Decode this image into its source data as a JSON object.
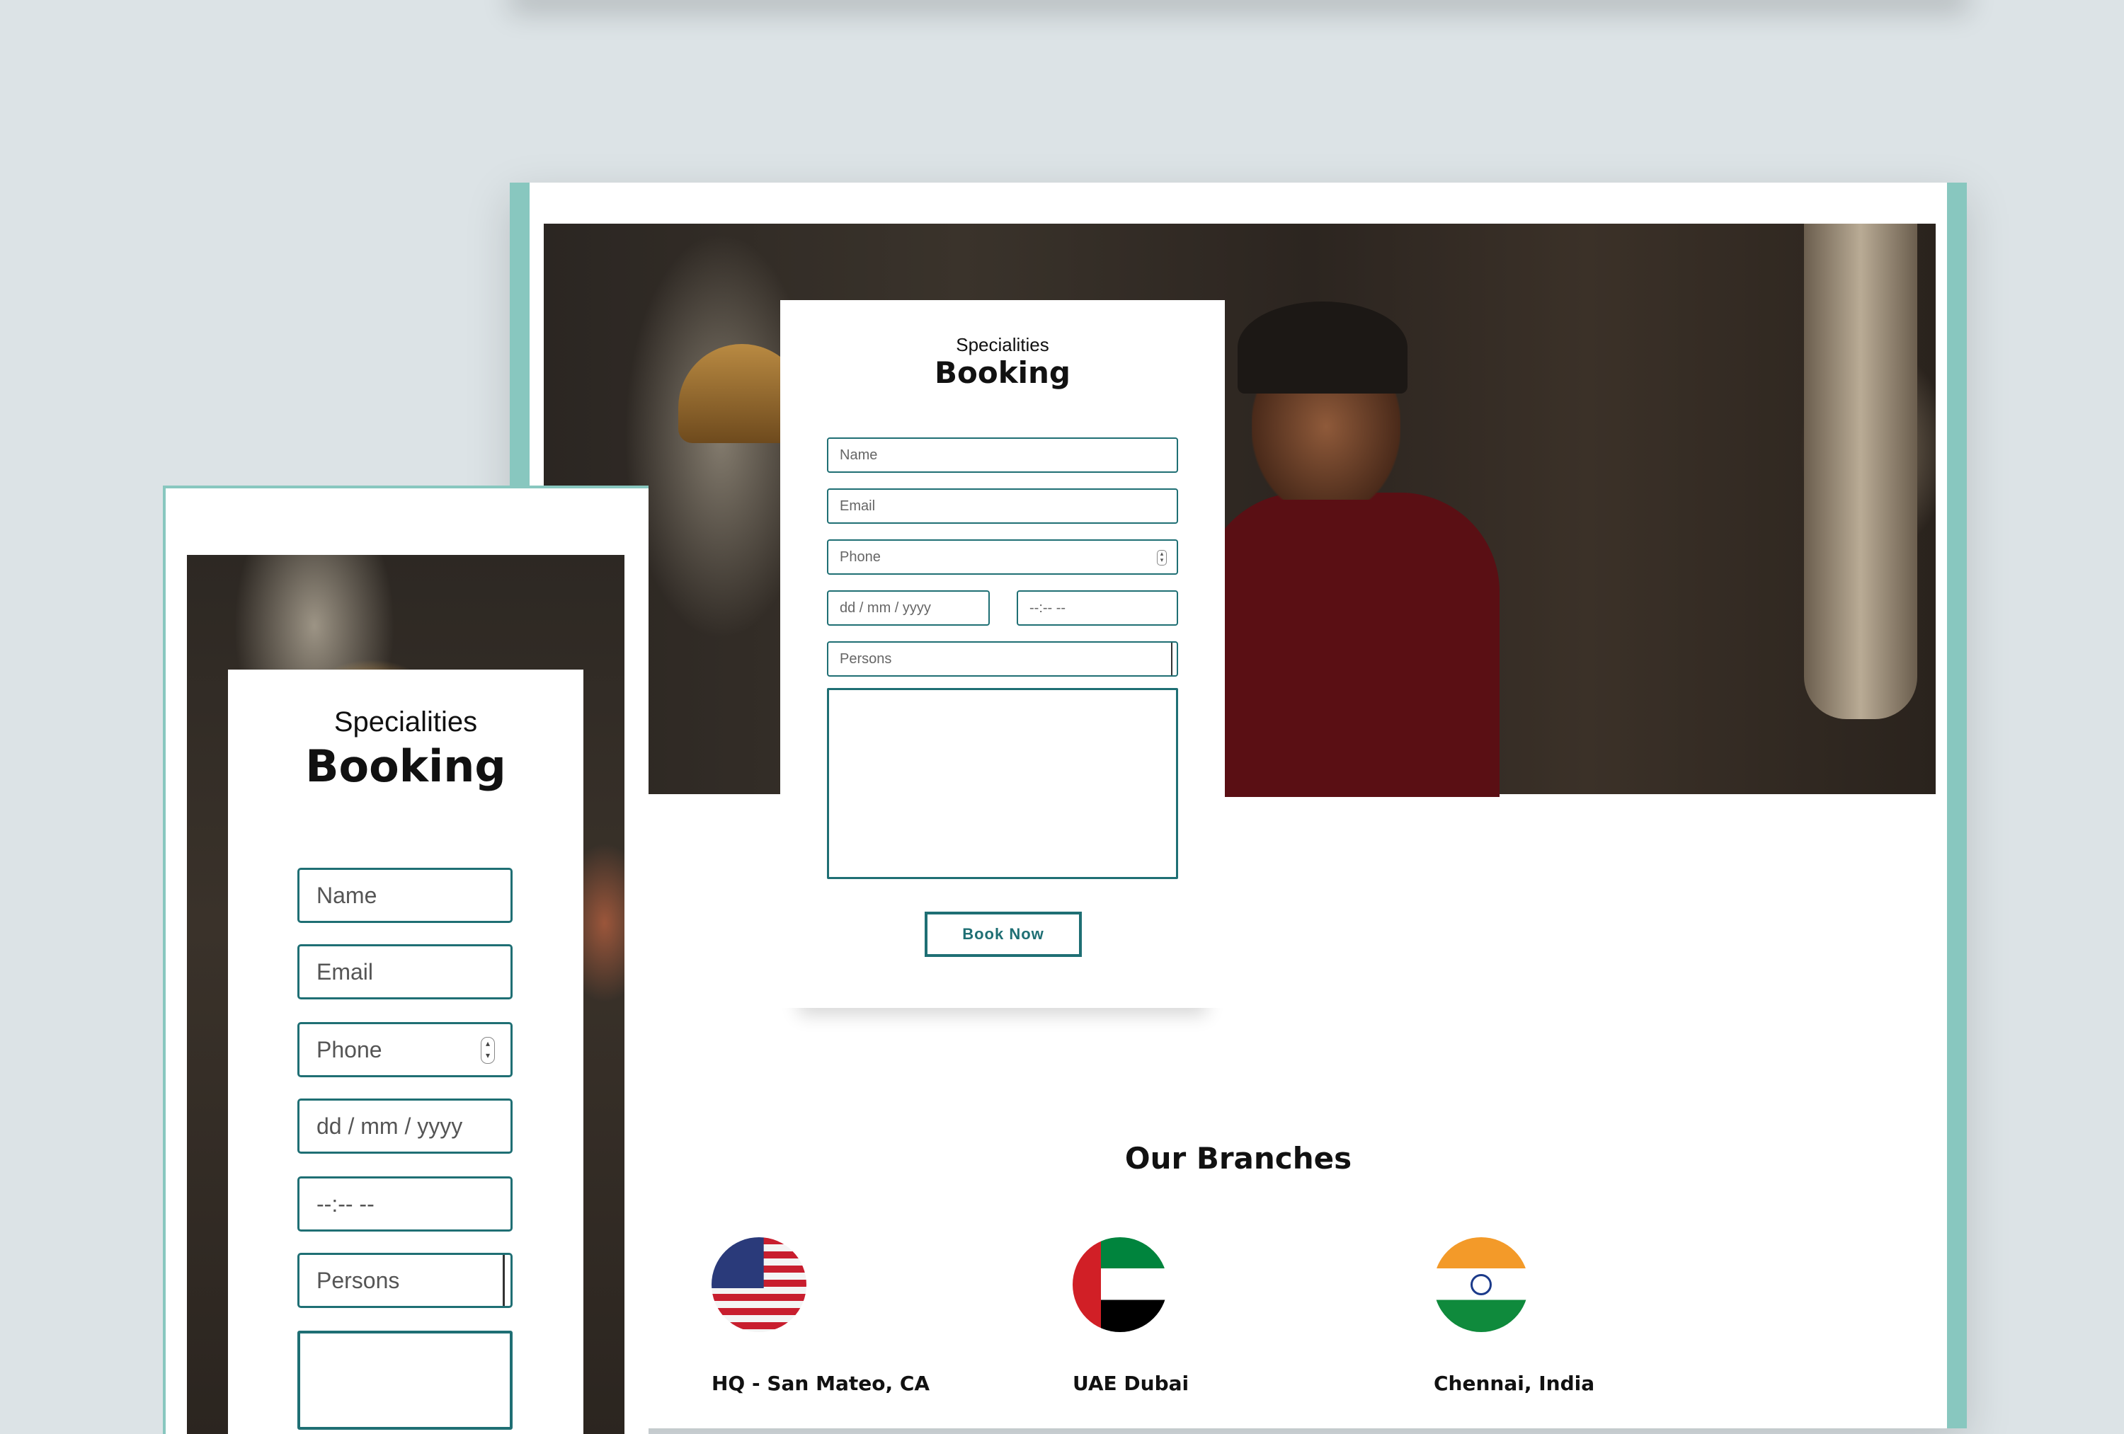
{
  "desktop": {
    "form": {
      "subtitle": "Specialities",
      "title": "Booking",
      "name_placeholder": "Name",
      "email_placeholder": "Email",
      "phone_placeholder": "Phone",
      "date_placeholder": "dd / mm / yyyy",
      "time_placeholder": "--:-- --",
      "persons_placeholder": "Persons",
      "submit_label": "Book Now"
    },
    "branches": {
      "title": "Our Branches",
      "items": [
        {
          "name": "HQ - San Mateo, CA",
          "flag": "usa-flag-icon"
        },
        {
          "name": "UAE Dubai",
          "flag": "uae-flag-icon"
        },
        {
          "name": "Chennai, India",
          "flag": "india-flag-icon"
        }
      ]
    }
  },
  "mobile": {
    "form": {
      "subtitle": "Specialities",
      "title": "Booking",
      "name_placeholder": "Name",
      "email_placeholder": "Email",
      "phone_placeholder": "Phone",
      "date_placeholder": "dd / mm / yyyy",
      "time_placeholder": "--:-- --",
      "persons_placeholder": "Persons"
    }
  },
  "colors": {
    "accent": "#1f6f74",
    "frame": "#88c7bf",
    "background": "#dce3e6"
  }
}
